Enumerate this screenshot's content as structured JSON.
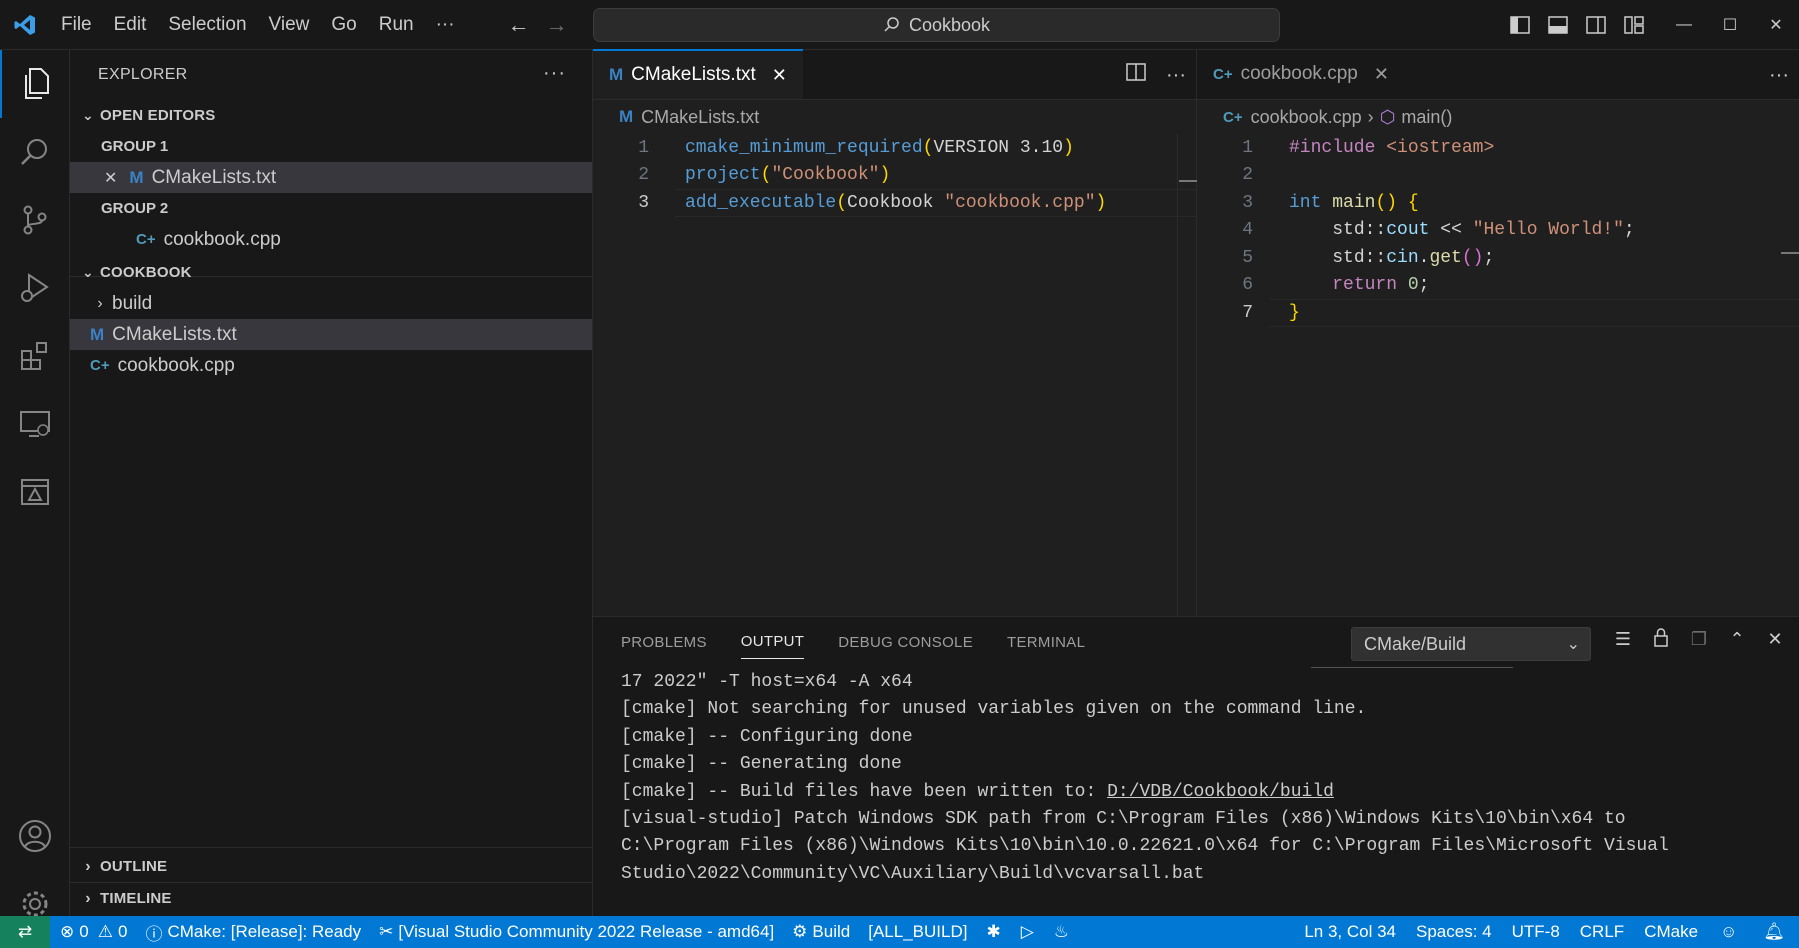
{
  "titlebar": {
    "menu": [
      "File",
      "Edit",
      "Selection",
      "View",
      "Go",
      "Run",
      "···"
    ],
    "search": "Cookbook"
  },
  "sidebar": {
    "title": "EXPLORER",
    "open_editors": "OPEN EDITORS",
    "group1": "GROUP 1",
    "group1_file": "CMakeLists.txt",
    "group2": "GROUP 2",
    "group2_file": "cookbook.cpp",
    "folder": "COOKBOOK",
    "tree": [
      {
        "label": "build"
      },
      {
        "label": "CMakeLists.txt"
      },
      {
        "label": "cookbook.cpp"
      }
    ],
    "outline": "OUTLINE",
    "timeline": "TIMELINE"
  },
  "editor1": {
    "tab": "CMakeLists.txt",
    "breadcrumb": "CMakeLists.txt",
    "line_numbers": [
      "1",
      "2",
      "3"
    ]
  },
  "editor2": {
    "tab": "cookbook.cpp",
    "breadcrumb_file": "cookbook.cpp",
    "breadcrumb_symbol": "main()",
    "line_numbers": [
      "1",
      "2",
      "3",
      "4",
      "5",
      "6",
      "7"
    ]
  },
  "panel": {
    "tabs": [
      "PROBLEMS",
      "OUTPUT",
      "DEBUG CONSOLE",
      "TERMINAL"
    ],
    "selected_channel": "CMake/Build",
    "output": [
      "17 2022\" -T host=x64 -A x64",
      "[cmake] Not searching for unused variables given on the command line.",
      "[cmake] -- Configuring done",
      "[cmake] -- Generating done",
      "[cmake] -- Build files have been written to: ",
      "[visual-studio] Patch Windows SDK path from C:\\Program Files (x86)\\Windows Kits\\10\\bin\\x64 to",
      "C:\\Program Files (x86)\\Windows Kits\\10\\bin\\10.0.22621.0\\x64 for C:\\Program Files\\Microsoft Visual",
      "Studio\\2022\\Community\\VC\\Auxiliary\\Build\\vcvarsall.bat"
    ],
    "output_link": "D:/VDB/Cookbook/build"
  },
  "status": {
    "errors": "0",
    "warnings": "0",
    "cmake": "CMake: [Release]: Ready",
    "kit": "[Visual Studio Community 2022 Release - amd64]",
    "build": "Build",
    "target": "[ALL_BUILD]",
    "position": "Ln 3, Col 34",
    "spaces": "Spaces: 4",
    "encoding": "UTF-8",
    "eol": "CRLF",
    "language": "CMake"
  },
  "colors": {
    "accent": "#0078d4",
    "status_bar": "#0078d4",
    "remote": "#16825d"
  }
}
